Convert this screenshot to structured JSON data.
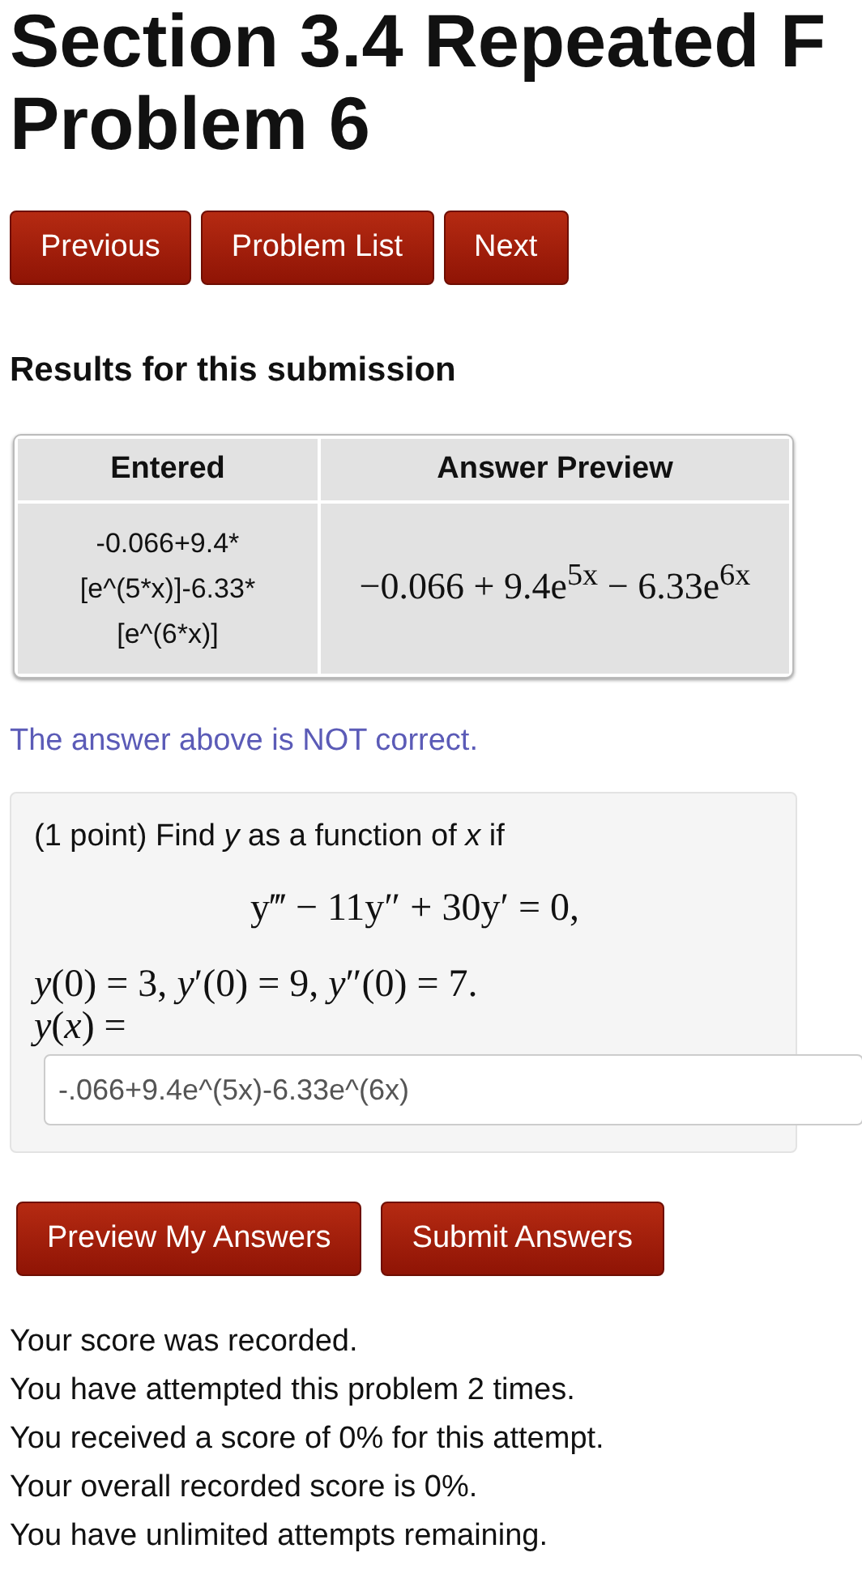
{
  "title": "Section 3.4 Repeated F",
  "subtitle": "Problem 6",
  "nav_buttons": [
    "Previous",
    "Problem List",
    "Next"
  ],
  "results_heading": "Results for this submission",
  "table": {
    "columns": [
      "Entered",
      "Answer Preview"
    ],
    "rows": [
      {
        "entered": [
          "-0.066+9.4*",
          "[e^(5*x)]-6.33*",
          "[e^(6*x)]"
        ],
        "preview": "−0.066 + 9.4e$^{5x}$ − 6.33e$^{6x}$"
      }
    ]
  },
  "result_message": "The answer above is NOT correct.",
  "problem": {
    "intro": "(1 point) Find *y* as a function of *x* if",
    "equation": "y‴ − 11y″ + 30y′ = 0,",
    "conditions": "*y*(0) = 3,  *y*′(0) = 9,  *y*″(0) = 7.",
    "answer_label": "*y*(*x*) =",
    "answer_value": "-.066+9.4e^(5x)-6.33e^(6x)"
  },
  "action_buttons": [
    "Preview My Answers",
    "Submit Answers"
  ],
  "status_lines": [
    "Your score was recorded.",
    "You have attempted this problem 2 times.",
    "You received a score of 0% for this attempt.",
    "Your overall recorded score is 0%.",
    "You have unlimited attempts remaining."
  ]
}
